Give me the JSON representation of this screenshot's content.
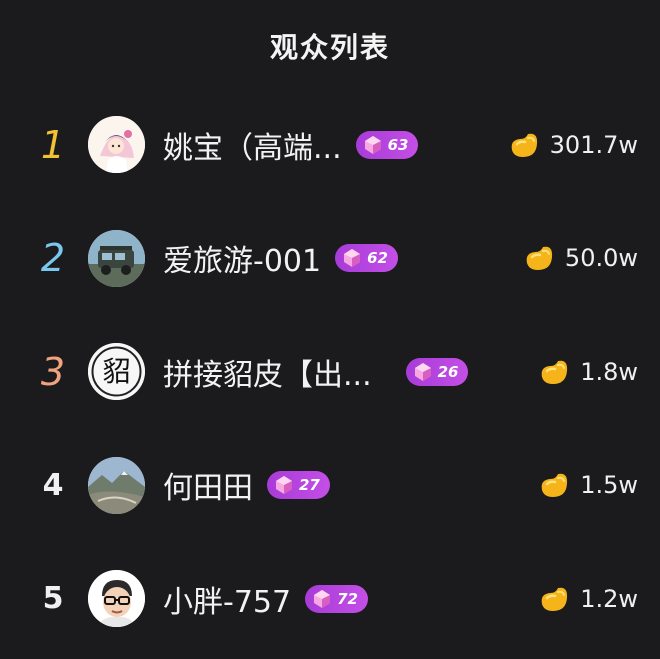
{
  "header": {
    "title": "观众列表"
  },
  "colors": {
    "background": "#1b1b1d",
    "rank1": "#f1c232",
    "rank2": "#79c9ee",
    "rank3": "#f0a37e",
    "badge": "#b644de",
    "coin": "#f4b41a"
  },
  "viewers": [
    {
      "rank": "1",
      "name": "姚宝（高端...",
      "level": "63",
      "coins": "301.7w",
      "avatar_icon": "anime-girl-avatar"
    },
    {
      "rank": "2",
      "name": "爱旅游-001",
      "level": "62",
      "coins": "50.0w",
      "avatar_icon": "jeep-avatar"
    },
    {
      "rank": "3",
      "name": "拼接貂皮【出...",
      "level": "26",
      "coins": "1.8w",
      "avatar_icon": "character-diao-avatar",
      "avatar_glyph": "貂"
    },
    {
      "rank": "4",
      "name": "何田田",
      "level": "27",
      "coins": "1.5w",
      "avatar_icon": "mountain-landscape-avatar"
    },
    {
      "rank": "5",
      "name": "小胖-757",
      "level": "72",
      "coins": "1.2w",
      "avatar_icon": "glasses-man-avatar"
    }
  ]
}
